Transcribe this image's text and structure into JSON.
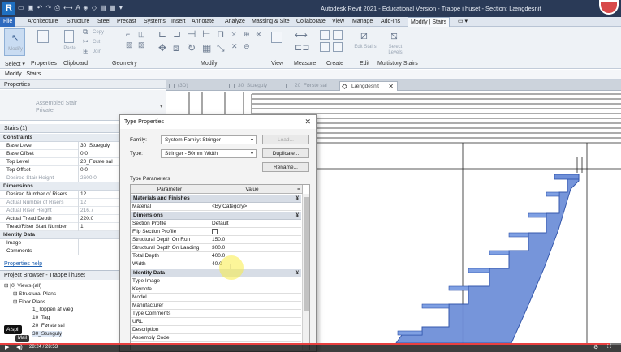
{
  "titlebar": {
    "logo": "R",
    "title": "Autodesk Revit 2021 - Educational Version - Trappe i huset - Section: Længdesnit"
  },
  "ribbon_tabs": [
    "File",
    "Architecture",
    "Structure",
    "Steel",
    "Precast",
    "Systems",
    "Insert",
    "Annotate",
    "Analyze",
    "Massing & Site",
    "Collaborate",
    "View",
    "Manage",
    "Add-Ins",
    "Modify | Stairs"
  ],
  "ribbon": {
    "groups": [
      "Select ▾",
      "Properties",
      "Clipboard",
      "Geometry",
      "Modify",
      "View",
      "Measure",
      "Create",
      "Edit",
      "Multistory Stairs"
    ],
    "modify_label": "Modify",
    "paste_label": "Paste",
    "copy_label": "Copy",
    "cut_label": "Cut",
    "join_label": "Join",
    "edit_stairs_label": "Edit Stairs",
    "select_levels_label": "Select Levels"
  },
  "context": {
    "label": "Modify | Stairs"
  },
  "properties": {
    "title": "Properties",
    "type_line1": "Assembled Stair",
    "type_line2": "Private",
    "instance": "Stairs (1)",
    "groups": {
      "constraints": "Constraints",
      "dimensions": "Dimensions",
      "identity": "Identity Data"
    },
    "rows": [
      {
        "label": "Base Level",
        "value": "30_Stueguly"
      },
      {
        "label": "Base Offset",
        "value": "0.0"
      },
      {
        "label": "Top Level",
        "value": "20_Første sal"
      },
      {
        "label": "Top Offset",
        "value": "0.0"
      },
      {
        "label": "Desired Stair Height",
        "value": "2600.0"
      },
      {
        "label": "Desired Number of Risers",
        "value": "12"
      },
      {
        "label": "Actual Number of Risers",
        "value": "12"
      },
      {
        "label": "Actual Riser Height",
        "value": "216.7"
      },
      {
        "label": "Actual Tread Depth",
        "value": "220.0"
      },
      {
        "label": "Tread/Riser Start Number",
        "value": "1"
      },
      {
        "label": "Image",
        "value": ""
      },
      {
        "label": "Comments",
        "value": ""
      }
    ],
    "help": "Properties help"
  },
  "browser": {
    "title": "Project Browser - Trappe i huset",
    "items": [
      "Views (all)",
      "Structural Plans",
      "Floor Plans",
      "1_Toppen af væg",
      "10_Tag",
      "20_Første sal",
      "30_Stueguly"
    ]
  },
  "view_tabs": [
    {
      "label": "(3D)"
    },
    {
      "label": "30_Stueguly"
    },
    {
      "label": "20_Første sal"
    },
    {
      "label": "Længdesnit",
      "close": "✕"
    }
  ],
  "dialog": {
    "title": "Type Properties",
    "close": "✕",
    "family_label": "Family:",
    "family_value": "System Family: Stringer",
    "type_label": "Type:",
    "type_value": "Stringer - 50mm Width",
    "load_btn": "Load...",
    "duplicate_btn": "Duplicate...",
    "rename_btn": "Rename...",
    "type_params_label": "Type Parameters",
    "col_param": "Parameter",
    "col_value": "Value",
    "col_eq": "=",
    "collapse": "¥",
    "groups": {
      "materials": "Materials and Finishes",
      "dimensions": "Dimensions",
      "identity": "Identity Data"
    },
    "rows_materials": [
      {
        "label": "Material",
        "value": "<By Category>"
      }
    ],
    "rows_dimensions": [
      {
        "label": "Section Profile",
        "value": "Default"
      },
      {
        "label": "Flip Section Profile",
        "value": ""
      },
      {
        "label": "Structural Depth On Run",
        "value": "150.0"
      },
      {
        "label": "Structural Depth On Landing",
        "value": "300.0"
      },
      {
        "label": "Total Depth",
        "value": "400.0"
      },
      {
        "label": "Width",
        "value": "40.0"
      }
    ],
    "rows_identity": [
      {
        "label": "Type Image",
        "value": ""
      },
      {
        "label": "Keynote",
        "value": ""
      },
      {
        "label": "Model",
        "value": ""
      },
      {
        "label": "Manufacturer",
        "value": ""
      },
      {
        "label": "Type Comments",
        "value": ""
      },
      {
        "label": "URL",
        "value": ""
      },
      {
        "label": "Description",
        "value": ""
      },
      {
        "label": "Assembly Code",
        "value": ""
      }
    ]
  },
  "video": {
    "time": "28:24 / 28:53",
    "progress": 0.983,
    "tooltip": "Afspil",
    "tooltip2": "Mail"
  },
  "colors": {
    "stair_fill": "#6f90d9",
    "stair_stroke": "#2c50a8",
    "title_bg": "#2a3a57"
  }
}
